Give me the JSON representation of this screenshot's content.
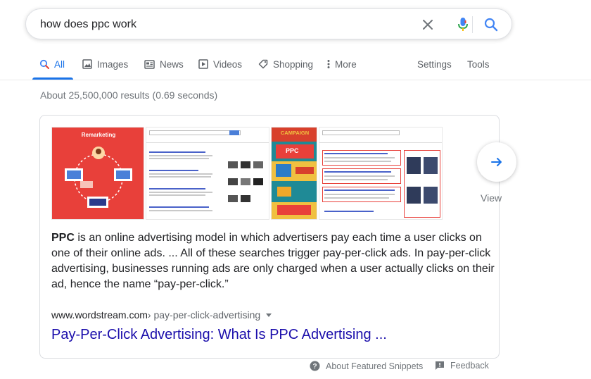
{
  "search": {
    "query": "how does ppc work"
  },
  "tabs": [
    {
      "label": "All"
    },
    {
      "label": "Images"
    },
    {
      "label": "News"
    },
    {
      "label": "Videos"
    },
    {
      "label": "Shopping"
    },
    {
      "label": "More"
    },
    {
      "label": "Settings"
    },
    {
      "label": "Tools"
    }
  ],
  "stats": "About 25,500,000 results (0.69 seconds)",
  "snippet": {
    "bold": "PPC",
    "text": " is an online advertising model in which advertisers pay each time a user clicks on one of their online ads. ... All of these searches trigger pay-per-click ads. In pay-per-click advertising, businesses running ads are only charged when a user actually clicks on their ad, hence the name “pay-per-click.”",
    "domain": "www.wordstream.com",
    "breadcrumb": " › pay-per-click-advertising",
    "title": "Pay-Per-Click Advertising: What Is PPC Advertising ..."
  },
  "thumbnails": {
    "remarketing_heading": "Remarketing",
    "campaign_heading": "CAMPAIGN",
    "campaign_ppc": "PPC"
  },
  "view_all_label": "View",
  "footer": {
    "about_label": "About Featured Snippets",
    "feedback_label": "Feedback"
  },
  "colors": {
    "accent": "#1a73e8",
    "link": "#1a0dab",
    "thumb_red": "#e8403a",
    "thumb_orange": "#f0a82a",
    "thumb_teal": "#1f8a96"
  }
}
